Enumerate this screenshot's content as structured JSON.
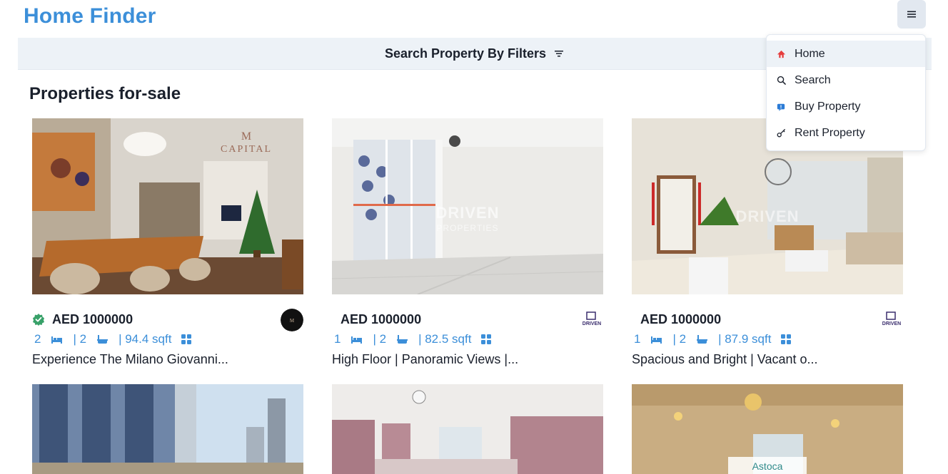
{
  "app": {
    "title": "Home Finder"
  },
  "filter_bar": {
    "label": "Search Property By Filters",
    "icon": "filter-lines-icon"
  },
  "section": {
    "title": "Properties for-sale"
  },
  "menu": {
    "button_icon": "hamburger-icon",
    "items": [
      {
        "label": "Home",
        "icon": "home-icon"
      },
      {
        "label": "Search",
        "icon": "search-icon"
      },
      {
        "label": "Buy Property",
        "icon": "badge-icon"
      },
      {
        "label": "Rent Property",
        "icon": "key-icon"
      }
    ]
  },
  "listings": [
    {
      "price": "AED 1000000",
      "verified": true,
      "rooms": "2",
      "baths": "| 2",
      "area": "| 94.4 sqft",
      "title": "Experience The Milano Giovanni...",
      "watermark": "CAPITAL"
    },
    {
      "price": "AED 1000000",
      "verified": false,
      "rooms": "1",
      "baths": "| 2",
      "area": "| 82.5 sqft",
      "title": "High Floor | Panoramic Views |...",
      "watermark": "DRIVEN"
    },
    {
      "price": "AED 1000000",
      "verified": false,
      "rooms": "1",
      "baths": "| 2",
      "area": "| 87.9 sqft",
      "title": "Spacious and Bright | Vacant o...",
      "watermark": "DRIVEN"
    }
  ],
  "colors": {
    "brand": "#3c8fd9",
    "verified": "#38a169",
    "bar": "#edf2f7"
  }
}
